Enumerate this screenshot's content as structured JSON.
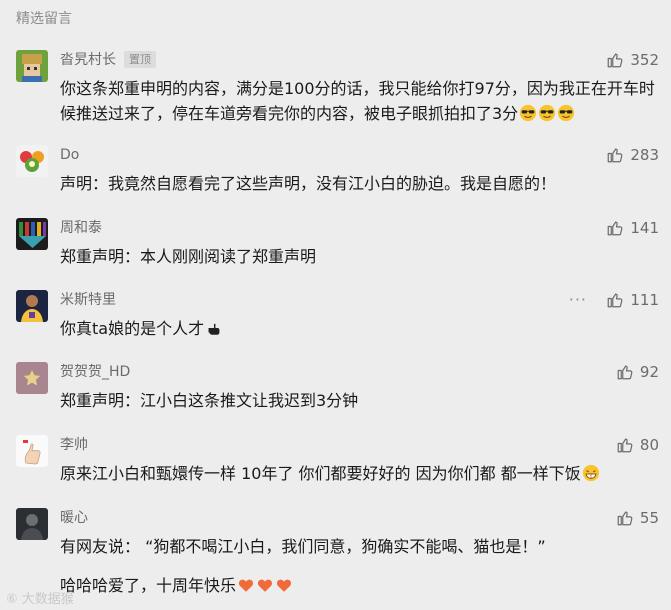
{
  "section": {
    "title": "精选留言"
  },
  "comments": [
    {
      "nickname": "沓旯村长",
      "badge": "置顶",
      "likes": "352",
      "text": "你这条郑重申明的内容，满分是100分的话，我只能给你打97分，因为我正在开车时候推送过来了，停在车道旁看完你的内容，被电子眼抓拍扣了3分"
    },
    {
      "nickname": "Do",
      "likes": "283",
      "text": "声明：我竟然自愿看完了这些声明，没有江小白的胁迫。我是自愿的！"
    },
    {
      "nickname": "周和泰",
      "likes": "141",
      "text": "郑重声明：本人刚刚阅读了郑重声明"
    },
    {
      "nickname": "米斯特里",
      "likes": "111",
      "more": "···",
      "text": "你真ta娘的是个人才"
    },
    {
      "nickname": "贺贺贺_HD",
      "likes": "92",
      "text": "郑重声明：江小白这条推文让我迟到3分钟"
    },
    {
      "nickname": "李帅",
      "likes": "80",
      "text": "原来江小白和甄嬛传一样  10年了   你们都要好好的  因为你们都  都一样下饭"
    },
    {
      "nickname": "暖心",
      "likes": "55",
      "text": "有网友说：  “狗都不喝江小白，我们同意，狗确实不能喝、猫也是！”",
      "text2": "哈哈哈爱了，十周年快乐"
    }
  ],
  "watermark": "⑥ 大数据猴",
  "colors": {
    "background": "#ededed",
    "nickname": "#6b6b6b",
    "text": "#1a1a1a"
  }
}
